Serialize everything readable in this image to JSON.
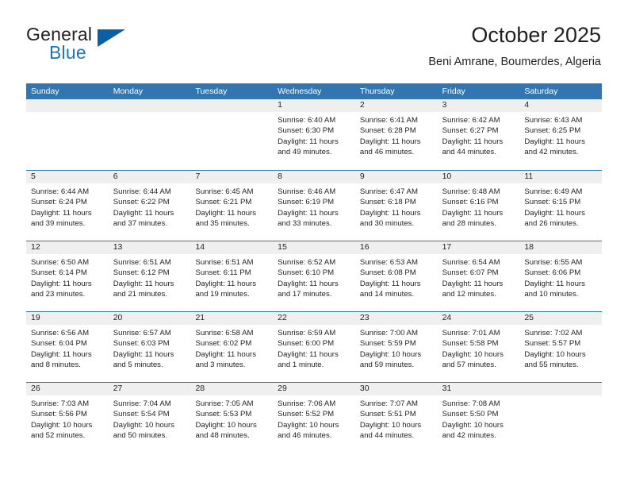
{
  "brand": {
    "name_part1": "General",
    "name_part2": "Blue",
    "logo_icon": "blue-triangle-icon"
  },
  "header": {
    "title": "October 2025",
    "subtitle": "Beni Amrane, Boumerdes, Algeria"
  },
  "colors": {
    "header_blue": "#3275b0",
    "brand_blue": "#1b75bb",
    "logo_dark_blue": "#0b5fa5",
    "day_band_gray": "#efefef",
    "text": "#231f20"
  },
  "weekdays": [
    "Sunday",
    "Monday",
    "Tuesday",
    "Wednesday",
    "Thursday",
    "Friday",
    "Saturday"
  ],
  "weeks": [
    [
      {
        "day": "",
        "empty": true,
        "lines": []
      },
      {
        "day": "",
        "empty": true,
        "lines": []
      },
      {
        "day": "",
        "empty": true,
        "lines": []
      },
      {
        "day": "1",
        "empty": false,
        "lines": [
          "Sunrise: 6:40 AM",
          "Sunset: 6:30 PM",
          "Daylight: 11 hours",
          "and 49 minutes."
        ]
      },
      {
        "day": "2",
        "empty": false,
        "lines": [
          "Sunrise: 6:41 AM",
          "Sunset: 6:28 PM",
          "Daylight: 11 hours",
          "and 46 minutes."
        ]
      },
      {
        "day": "3",
        "empty": false,
        "lines": [
          "Sunrise: 6:42 AM",
          "Sunset: 6:27 PM",
          "Daylight: 11 hours",
          "and 44 minutes."
        ]
      },
      {
        "day": "4",
        "empty": false,
        "lines": [
          "Sunrise: 6:43 AM",
          "Sunset: 6:25 PM",
          "Daylight: 11 hours",
          "and 42 minutes."
        ]
      }
    ],
    [
      {
        "day": "5",
        "empty": false,
        "lines": [
          "Sunrise: 6:44 AM",
          "Sunset: 6:24 PM",
          "Daylight: 11 hours",
          "and 39 minutes."
        ]
      },
      {
        "day": "6",
        "empty": false,
        "lines": [
          "Sunrise: 6:44 AM",
          "Sunset: 6:22 PM",
          "Daylight: 11 hours",
          "and 37 minutes."
        ]
      },
      {
        "day": "7",
        "empty": false,
        "lines": [
          "Sunrise: 6:45 AM",
          "Sunset: 6:21 PM",
          "Daylight: 11 hours",
          "and 35 minutes."
        ]
      },
      {
        "day": "8",
        "empty": false,
        "lines": [
          "Sunrise: 6:46 AM",
          "Sunset: 6:19 PM",
          "Daylight: 11 hours",
          "and 33 minutes."
        ]
      },
      {
        "day": "9",
        "empty": false,
        "lines": [
          "Sunrise: 6:47 AM",
          "Sunset: 6:18 PM",
          "Daylight: 11 hours",
          "and 30 minutes."
        ]
      },
      {
        "day": "10",
        "empty": false,
        "lines": [
          "Sunrise: 6:48 AM",
          "Sunset: 6:16 PM",
          "Daylight: 11 hours",
          "and 28 minutes."
        ]
      },
      {
        "day": "11",
        "empty": false,
        "lines": [
          "Sunrise: 6:49 AM",
          "Sunset: 6:15 PM",
          "Daylight: 11 hours",
          "and 26 minutes."
        ]
      }
    ],
    [
      {
        "day": "12",
        "empty": false,
        "lines": [
          "Sunrise: 6:50 AM",
          "Sunset: 6:14 PM",
          "Daylight: 11 hours",
          "and 23 minutes."
        ]
      },
      {
        "day": "13",
        "empty": false,
        "lines": [
          "Sunrise: 6:51 AM",
          "Sunset: 6:12 PM",
          "Daylight: 11 hours",
          "and 21 minutes."
        ]
      },
      {
        "day": "14",
        "empty": false,
        "lines": [
          "Sunrise: 6:51 AM",
          "Sunset: 6:11 PM",
          "Daylight: 11 hours",
          "and 19 minutes."
        ]
      },
      {
        "day": "15",
        "empty": false,
        "lines": [
          "Sunrise: 6:52 AM",
          "Sunset: 6:10 PM",
          "Daylight: 11 hours",
          "and 17 minutes."
        ]
      },
      {
        "day": "16",
        "empty": false,
        "lines": [
          "Sunrise: 6:53 AM",
          "Sunset: 6:08 PM",
          "Daylight: 11 hours",
          "and 14 minutes."
        ]
      },
      {
        "day": "17",
        "empty": false,
        "lines": [
          "Sunrise: 6:54 AM",
          "Sunset: 6:07 PM",
          "Daylight: 11 hours",
          "and 12 minutes."
        ]
      },
      {
        "day": "18",
        "empty": false,
        "lines": [
          "Sunrise: 6:55 AM",
          "Sunset: 6:06 PM",
          "Daylight: 11 hours",
          "and 10 minutes."
        ]
      }
    ],
    [
      {
        "day": "19",
        "empty": false,
        "lines": [
          "Sunrise: 6:56 AM",
          "Sunset: 6:04 PM",
          "Daylight: 11 hours",
          "and 8 minutes."
        ]
      },
      {
        "day": "20",
        "empty": false,
        "lines": [
          "Sunrise: 6:57 AM",
          "Sunset: 6:03 PM",
          "Daylight: 11 hours",
          "and 5 minutes."
        ]
      },
      {
        "day": "21",
        "empty": false,
        "lines": [
          "Sunrise: 6:58 AM",
          "Sunset: 6:02 PM",
          "Daylight: 11 hours",
          "and 3 minutes."
        ]
      },
      {
        "day": "22",
        "empty": false,
        "lines": [
          "Sunrise: 6:59 AM",
          "Sunset: 6:00 PM",
          "Daylight: 11 hours",
          "and 1 minute."
        ]
      },
      {
        "day": "23",
        "empty": false,
        "lines": [
          "Sunrise: 7:00 AM",
          "Sunset: 5:59 PM",
          "Daylight: 10 hours",
          "and 59 minutes."
        ]
      },
      {
        "day": "24",
        "empty": false,
        "lines": [
          "Sunrise: 7:01 AM",
          "Sunset: 5:58 PM",
          "Daylight: 10 hours",
          "and 57 minutes."
        ]
      },
      {
        "day": "25",
        "empty": false,
        "lines": [
          "Sunrise: 7:02 AM",
          "Sunset: 5:57 PM",
          "Daylight: 10 hours",
          "and 55 minutes."
        ]
      }
    ],
    [
      {
        "day": "26",
        "empty": false,
        "lines": [
          "Sunrise: 7:03 AM",
          "Sunset: 5:56 PM",
          "Daylight: 10 hours",
          "and 52 minutes."
        ]
      },
      {
        "day": "27",
        "empty": false,
        "lines": [
          "Sunrise: 7:04 AM",
          "Sunset: 5:54 PM",
          "Daylight: 10 hours",
          "and 50 minutes."
        ]
      },
      {
        "day": "28",
        "empty": false,
        "lines": [
          "Sunrise: 7:05 AM",
          "Sunset: 5:53 PM",
          "Daylight: 10 hours",
          "and 48 minutes."
        ]
      },
      {
        "day": "29",
        "empty": false,
        "lines": [
          "Sunrise: 7:06 AM",
          "Sunset: 5:52 PM",
          "Daylight: 10 hours",
          "and 46 minutes."
        ]
      },
      {
        "day": "30",
        "empty": false,
        "lines": [
          "Sunrise: 7:07 AM",
          "Sunset: 5:51 PM",
          "Daylight: 10 hours",
          "and 44 minutes."
        ]
      },
      {
        "day": "31",
        "empty": false,
        "lines": [
          "Sunrise: 7:08 AM",
          "Sunset: 5:50 PM",
          "Daylight: 10 hours",
          "and 42 minutes."
        ]
      },
      {
        "day": "",
        "empty": true,
        "lines": []
      }
    ]
  ]
}
